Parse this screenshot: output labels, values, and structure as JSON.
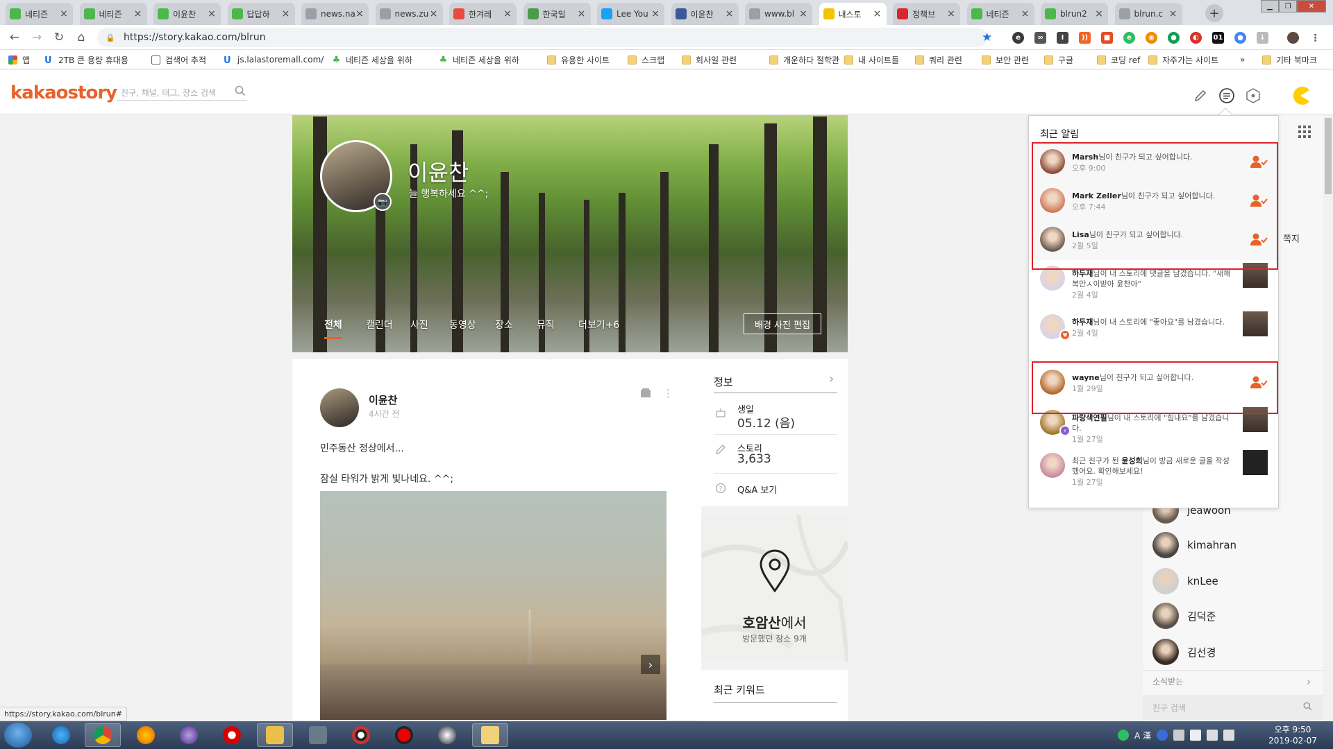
{
  "browser": {
    "tabs": [
      {
        "title": "네티즌",
        "color": "#4cb84c"
      },
      {
        "title": "네티즌",
        "color": "#4cb84c"
      },
      {
        "title": "이윤찬",
        "color": "#4cb84c"
      },
      {
        "title": "답답하",
        "color": "#4cb84c"
      },
      {
        "title": "news.na",
        "color": "#9aa0a6"
      },
      {
        "title": "news.zu",
        "color": "#9aa0a6"
      },
      {
        "title": "한겨레",
        "color": "#e94a3f"
      },
      {
        "title": "한국일",
        "color": "#4a9c4a"
      },
      {
        "title": "Lee You",
        "color": "#1da1f2"
      },
      {
        "title": "이윤찬",
        "color": "#3b5998"
      },
      {
        "title": "www.bl",
        "color": "#9aa0a6"
      },
      {
        "title": "내스토",
        "color": "#f5c400"
      },
      {
        "title": "정책브",
        "color": "#d8262e"
      },
      {
        "title": "네티즌",
        "color": "#4cb84c"
      },
      {
        "title": "blrun2",
        "color": "#4cb84c"
      },
      {
        "title": "blrun.c",
        "color": "#9aa0a6"
      }
    ],
    "active_tab_index": 11,
    "new_tab_symbol": "+",
    "url": "https://story.kakao.com/blrun",
    "bookmarks": [
      {
        "label": "앱",
        "icon": "apps-icon"
      },
      {
        "label": "2TB 큰 용량 휴대용",
        "icon": "u-icon"
      },
      {
        "label": "검색어 추적",
        "icon": "page-icon"
      },
      {
        "label": "js.lalastoremall.com/",
        "icon": "u-icon"
      },
      {
        "label": "네티즌 세상을 위하",
        "icon": "leaf-icon"
      },
      {
        "label": "네티즌 세상을 위하",
        "icon": "leaf-icon"
      },
      {
        "label": "유용한 사이트",
        "icon": "folder-icon"
      },
      {
        "label": "스크랩",
        "icon": "folder-icon"
      },
      {
        "label": "회사일 관련",
        "icon": "folder-icon"
      },
      {
        "label": "개운하다 절학관",
        "icon": "folder-icon"
      },
      {
        "label": "내 사이트들",
        "icon": "folder-icon"
      },
      {
        "label": "쿼리 관련",
        "icon": "folder-icon"
      },
      {
        "label": "보안 관련",
        "icon": "folder-icon"
      },
      {
        "label": "구글",
        "icon": "folder-icon"
      },
      {
        "label": "코딩 ref",
        "icon": "folder-icon"
      },
      {
        "label": "자주가는 사이트",
        "icon": "folder-icon"
      },
      {
        "label": "»",
        "icon": ""
      },
      {
        "label": "기타 북마크",
        "icon": "folder-icon"
      }
    ]
  },
  "kakao": {
    "logo_part1": "kakao",
    "logo_part2": "story",
    "search_placeholder": "친구, 채널, 태그, 장소 검색",
    "accent": "#e8622a"
  },
  "profile": {
    "name": "이윤찬",
    "status": "늘 행복하세요 ^^;",
    "tabs": [
      "전체",
      "캘린더",
      "사진",
      "동영상",
      "장소",
      "뮤직",
      "더보기+6"
    ],
    "active_tab": 0,
    "edit_cover_label": "배경 사진 편집"
  },
  "post": {
    "author": "이윤찬",
    "time": "4시간 전",
    "line1": "민주동산 정상에서...",
    "line2": "잠실 타워가 밝게 빛나네요. ^^;"
  },
  "info": {
    "title": "정보",
    "birthday_label": "생일",
    "birthday_value": "05.12 (음)",
    "story_label": "스토리",
    "story_value": "3,633",
    "qa_label": "Q&A 보기"
  },
  "map": {
    "place": "호암산",
    "place_suffix": "에서",
    "visited": "방문했던 장소 9개"
  },
  "keywords": {
    "title": "최근 키워드"
  },
  "notifications": {
    "title": "최근 알림",
    "items": [
      {
        "name": "Marsh",
        "text": "님이 친구가 되고 싶어합니다.",
        "time": "오후 9:00",
        "kind": "friend",
        "avatar": "#8c4a3a"
      },
      {
        "name": "Mark Zeller",
        "text": "님이 친구가 되고 싶어합니다.",
        "time": "오후 7:44",
        "kind": "friend",
        "avatar": "#d07b5a"
      },
      {
        "name": "Lisa",
        "text": "님이 친구가 되고 싶어합니다.",
        "time": "2월 5일",
        "kind": "friend",
        "avatar": "#6b5a4e"
      },
      {
        "name": "하두재",
        "text": "님이 내 스토리에 댓글을 남겼습니다. \"새해복만ㅅ이받아 윤찬아\"",
        "time": "2월 4일",
        "kind": "comment",
        "avatar": "#d9d2e8"
      },
      {
        "name": "하두재",
        "text": "님이 내 스토리에 \"좋아요\"를 남겼습니다.",
        "time": "2월 4일",
        "kind": "like",
        "avatar": "#d9d2e8"
      },
      {
        "name": "wayne",
        "text": "님이 친구가 되고 싶어합니다.",
        "time": "1월 29일",
        "kind": "friend",
        "avatar": "#b46a2a"
      },
      {
        "name": "파랑색연필",
        "text": "님이 내 스토리에 \"힘내요\"를 남겼습니다.",
        "time": "1월 27일",
        "kind": "cheer",
        "avatar": "#a0782a"
      },
      {
        "name": "윤성희",
        "text": "님이 방금 새로운 글을 작성했어요. 확인해보세요!",
        "prefix": "최근 친구가 된 ",
        "time": "1월 27일",
        "kind": "new",
        "avatar": "#c98aa0"
      }
    ]
  },
  "friends_panel": {
    "note_label": "쪽지",
    "friends": [
      {
        "name": "jeawoon",
        "avatar": "#6b5a4e"
      },
      {
        "name": "kimahran",
        "avatar": "#4a4540"
      },
      {
        "name": "knLee",
        "avatar": "#d0d0d0"
      },
      {
        "name": "김덕준",
        "avatar": "#5a5049"
      },
      {
        "name": "김선경",
        "avatar": "#3a2a22"
      }
    ],
    "follow_label": "소식받는",
    "search_placeholder": "친구 검색"
  },
  "status_url": "https://story.kakao.com/blrun#",
  "taskbar": {
    "clock_time": "오후 9:50",
    "clock_date": "2019-02-07",
    "ime_label": "A 漢"
  }
}
